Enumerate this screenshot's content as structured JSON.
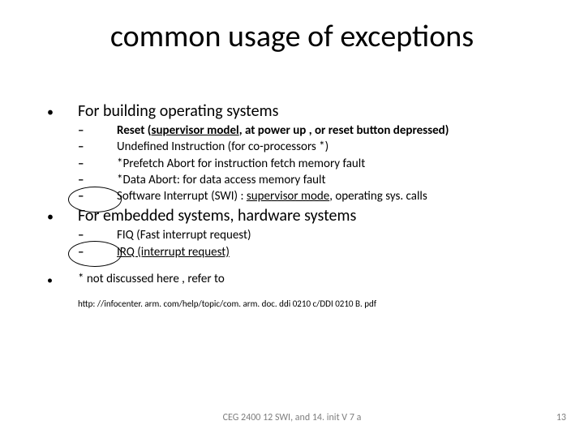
{
  "title": "common usage of exceptions",
  "sections": [
    {
      "heading": "For building operating systems",
      "items": [
        {
          "pre": "Reset (",
          "u": "supervisor model",
          "post": ", at power up , or reset button depressed)",
          "bold": true
        },
        {
          "pre": "Undefined Instruction (for co-processors *)",
          "u": "",
          "post": ""
        },
        {
          "pre": "*Prefetch Abort for instruction fetch memory fault",
          "u": "",
          "post": ""
        },
        {
          "pre": "*Data Abort: for data access memory fault",
          "u": "",
          "post": ""
        },
        {
          "pre": "Software Interrupt (SWI) : ",
          "u": "supervisor mode",
          "post": ", operating sys. calls"
        }
      ]
    },
    {
      "heading": "For embedded systems, hardware systems",
      "items": [
        {
          "pre": "FIQ (Fast interrupt request)",
          "u": "",
          "post": ""
        },
        {
          "all_u": "IRQ (interrupt request)"
        }
      ]
    }
  ],
  "note": "* not discussed here , refer to",
  "ref": "http: //infocenter. arm. com/help/topic/com. arm. doc. ddi 0210 c/DDI 0210 B. pdf",
  "footer": "CEG 2400 12 SWI, and 14. init V 7 a",
  "page": "13",
  "bullets": {
    "dot": "•",
    "dash": "–"
  }
}
